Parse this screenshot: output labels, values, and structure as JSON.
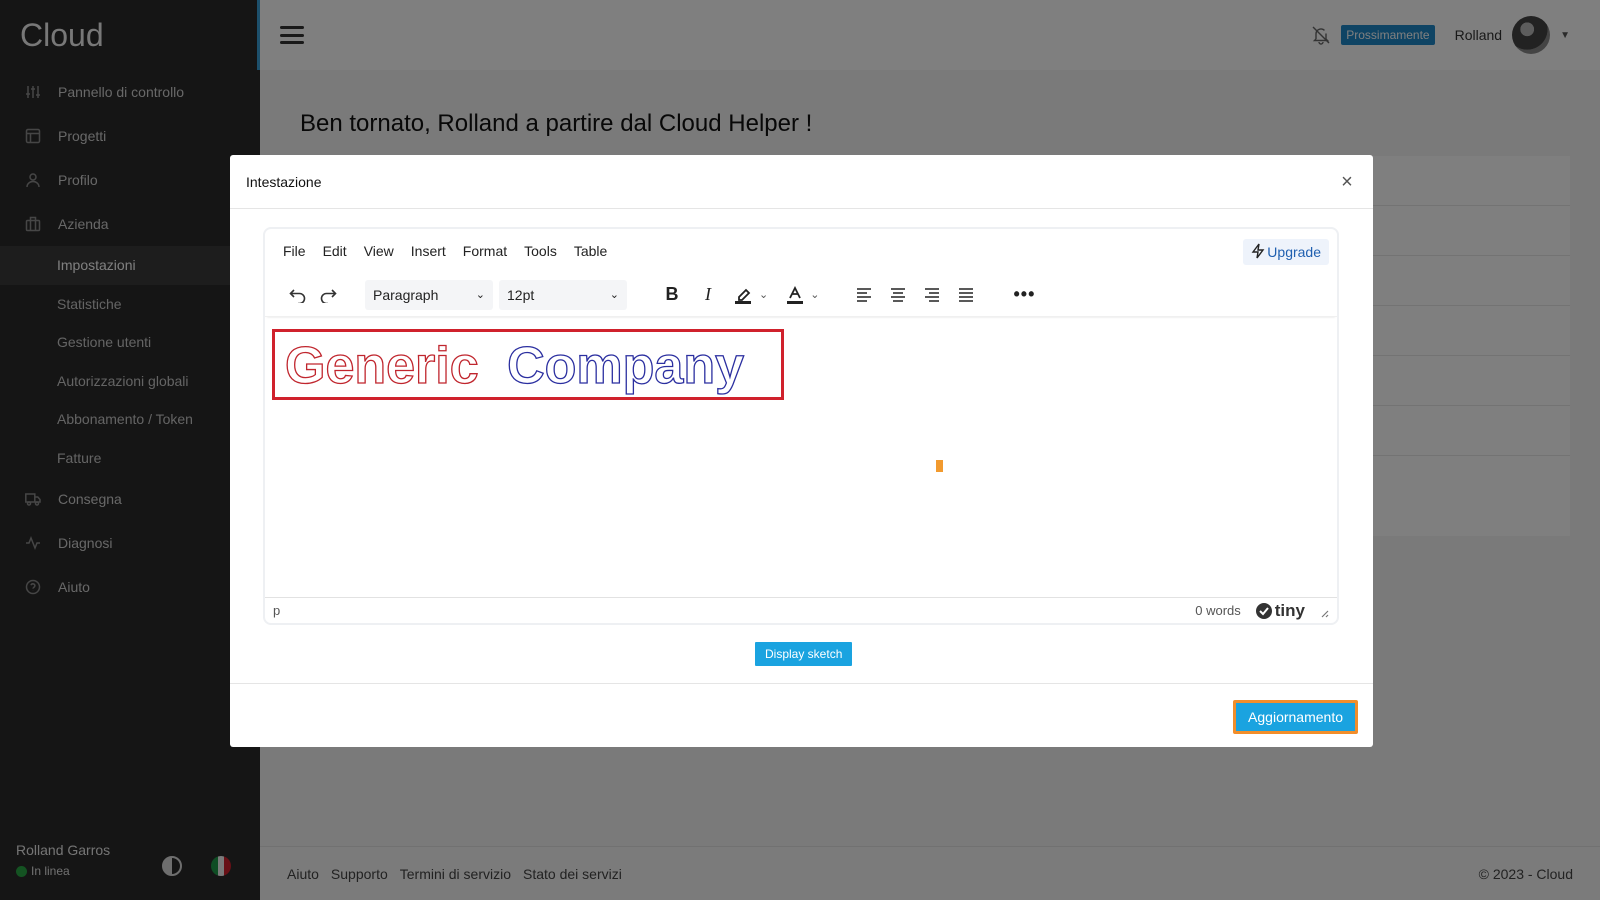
{
  "sidebar": {
    "brand": "Cloud",
    "items": [
      {
        "label": "Pannello di controllo",
        "icon": "sliders-icon"
      },
      {
        "label": "Progetti",
        "icon": "layout-icon"
      },
      {
        "label": "Profilo",
        "icon": "user-icon"
      },
      {
        "label": "Azienda",
        "icon": "building-icon"
      }
    ],
    "subitems": [
      "Impostazioni",
      "Statistiche",
      "Gestione utenti",
      "Autorizzazioni globali",
      "Abbonamento / Token",
      "Fatture"
    ],
    "bottom_items": [
      {
        "label": "Consegna",
        "icon": "truck-icon"
      },
      {
        "label": "Diagnosi",
        "icon": "activity-icon"
      },
      {
        "label": "Aiuto",
        "icon": "help-circle-icon"
      }
    ],
    "user_name": "Rolland Garros",
    "status": "In linea"
  },
  "topbar": {
    "badge": "Prossimamente",
    "user": "Rolland"
  },
  "main": {
    "welcome": "Ben tornato, Rolland a partire dal Cloud Helper !"
  },
  "footer": {
    "links": [
      "Aiuto",
      "Supporto",
      "Termini di servizio",
      "Stato dei servizi"
    ],
    "copyright": "© 2023 - Cloud"
  },
  "modal": {
    "title": "Intestazione",
    "menu": [
      "File",
      "Edit",
      "View",
      "Insert",
      "Format",
      "Tools",
      "Table"
    ],
    "upgrade": "Upgrade",
    "block_format": "Paragraph",
    "font_size": "12pt",
    "content": {
      "word1": "Generic",
      "word2": "Company"
    },
    "status_path": "p",
    "word_count": "0 words",
    "tiny_brand": "tiny",
    "sketch_button": "Display sketch",
    "update_button": "Aggiornamento"
  },
  "colors": {
    "accent": "#1aa3e0",
    "highlight_border": "#d0212c",
    "focus_border": "#f28e2b",
    "company_word1": "#c0262e",
    "company_word2": "#2b2fa0"
  }
}
